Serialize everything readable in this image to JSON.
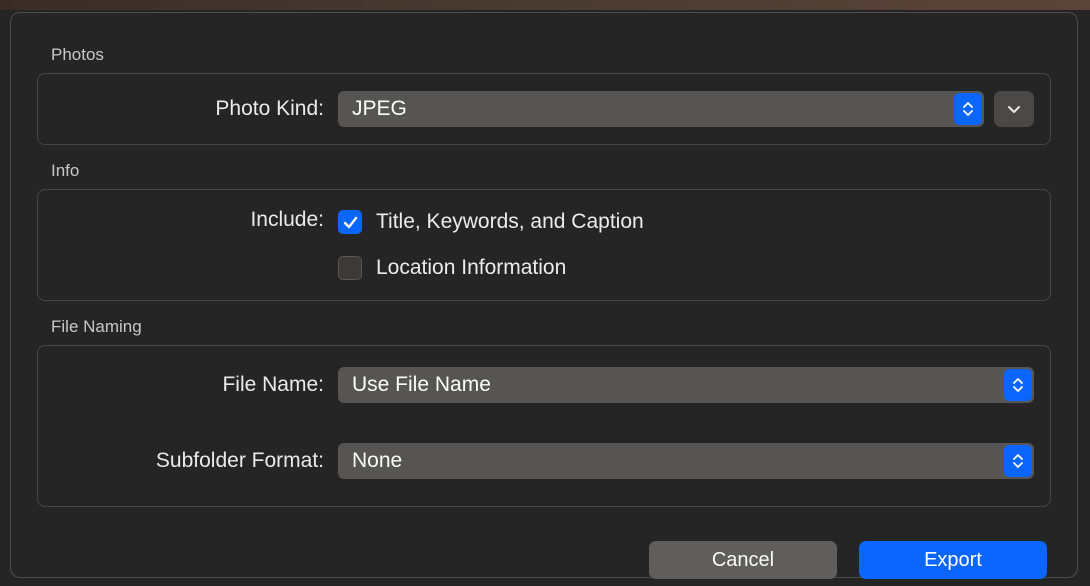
{
  "sections": {
    "photos": {
      "label": "Photos",
      "photoKind": {
        "label": "Photo Kind:",
        "value": "JPEG"
      }
    },
    "info": {
      "label": "Info",
      "include": {
        "label": "Include:",
        "titleKeywordsCaption": {
          "label": "Title, Keywords, and Caption",
          "checked": true
        },
        "locationInformation": {
          "label": "Location Information",
          "checked": false
        }
      }
    },
    "fileNaming": {
      "label": "File Naming",
      "fileName": {
        "label": "File Name:",
        "value": "Use File Name"
      },
      "subfolderFormat": {
        "label": "Subfolder Format:",
        "value": "None"
      }
    }
  },
  "footer": {
    "cancel": "Cancel",
    "export": "Export"
  }
}
